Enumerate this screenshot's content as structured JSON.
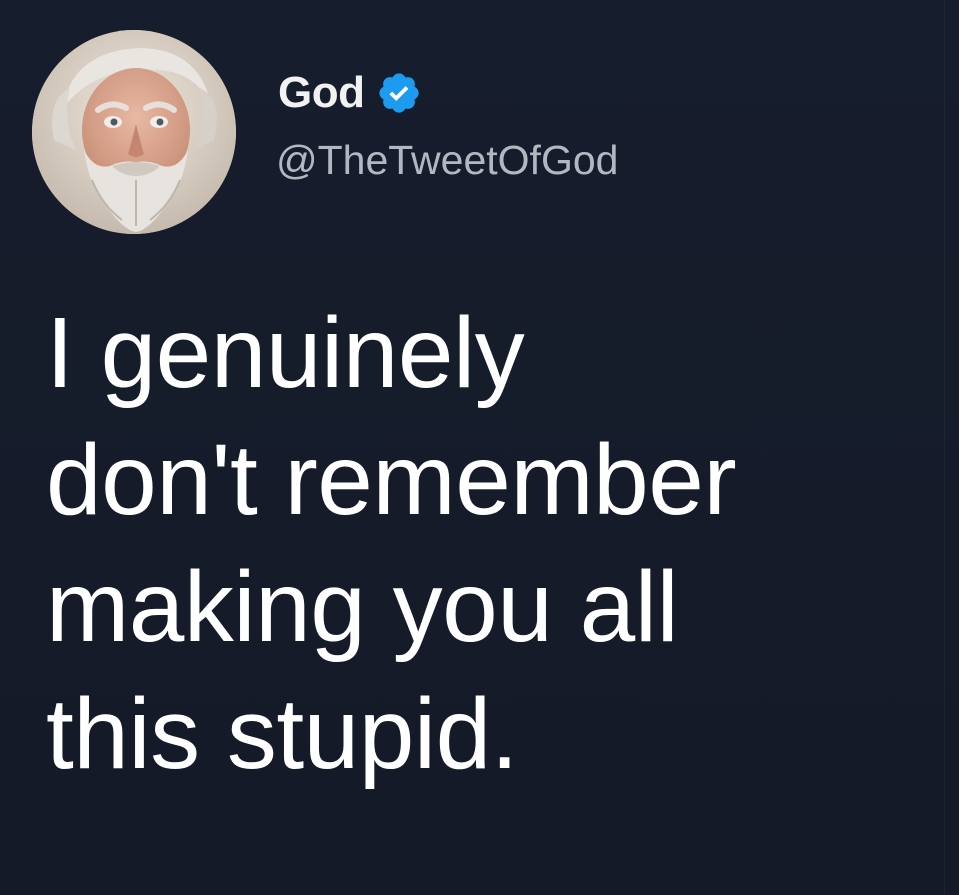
{
  "tweet": {
    "author": {
      "display_name": "God",
      "handle": "@TheTweetOfGod",
      "verified": true,
      "verified_icon": "verified-check-badge",
      "avatar_icon": "bearded-man-portrait"
    },
    "text_lines": [
      "I genuinely",
      "don't remember",
      "making you all",
      "this stupid."
    ]
  },
  "colors": {
    "background": "#161c2a",
    "text": "#ffffff",
    "handle": "#b3b8c0",
    "verified_blue": "#1d9bf0"
  }
}
